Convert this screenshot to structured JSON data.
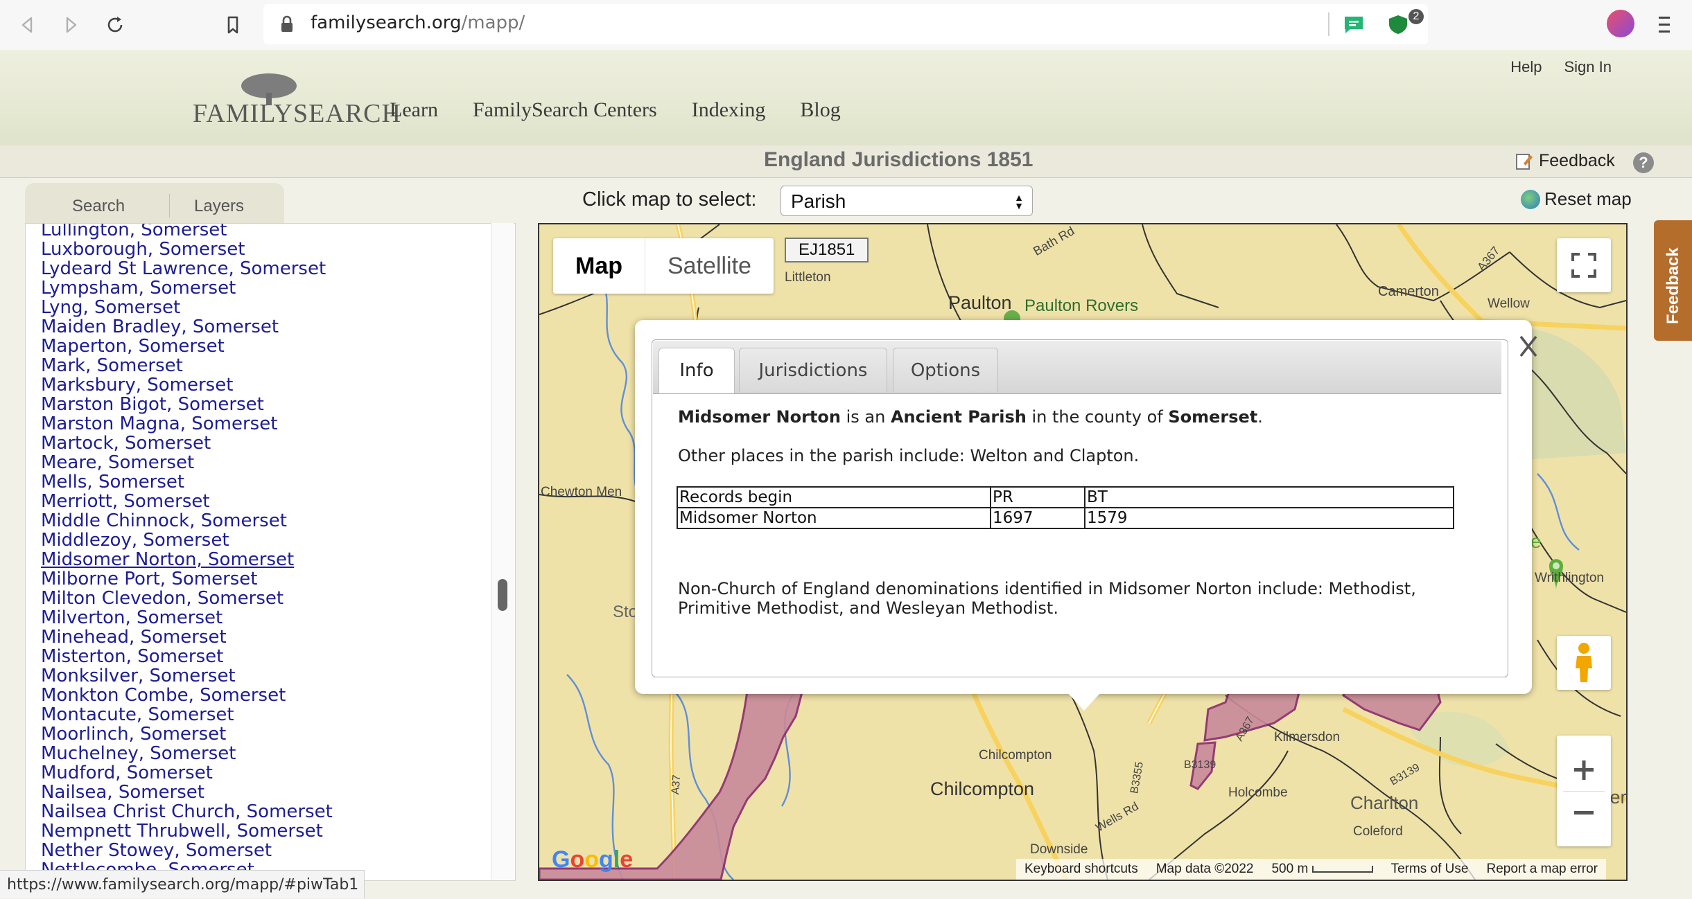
{
  "browser": {
    "url_host": "familysearch.org",
    "url_path": "/mapp/",
    "extension_badge": "2",
    "status_url": "https://www.familysearch.org/mapp/#piwTab1"
  },
  "site": {
    "logo_text": "FAMILYSEARCH",
    "nav": [
      "Learn",
      "FamilySearch Centers",
      "Indexing",
      "Blog"
    ],
    "help": "Help",
    "sign_in": "Sign In"
  },
  "title_bar": {
    "title": "England Jurisdictions 1851",
    "feedback": "Feedback",
    "help_glyph": "?"
  },
  "left_panel": {
    "tabs": [
      "Search",
      "Layers"
    ],
    "places": [
      "Lullington, Somerset",
      "Luxborough, Somerset",
      "Lydeard St Lawrence, Somerset",
      "Lympsham, Somerset",
      "Lyng, Somerset",
      "Maiden Bradley, Somerset",
      "Maperton, Somerset",
      "Mark, Somerset",
      "Marksbury, Somerset",
      "Marston Bigot, Somerset",
      "Marston Magna, Somerset",
      "Martock, Somerset",
      "Meare, Somerset",
      "Mells, Somerset",
      "Merriott, Somerset",
      "Middle Chinnock, Somerset",
      "Middlezoy, Somerset",
      "Midsomer Norton, Somerset",
      "Milborne Port, Somerset",
      "Milton Clevedon, Somerset",
      "Milverton, Somerset",
      "Minehead, Somerset",
      "Misterton, Somerset",
      "Monksilver, Somerset",
      "Monkton Combe, Somerset",
      "Montacute, Somerset",
      "Moorlinch, Somerset",
      "Muchelney, Somerset",
      "Mudford, Somerset",
      "Nailsea, Somerset",
      "Nailsea Christ Church, Somerset",
      "Nempnett Thrubwell, Somerset",
      "Nether Stowey, Somerset",
      "Nettlecombe, Somerset"
    ],
    "active_index": 17
  },
  "map_controls": {
    "select_label": "Click map to select:",
    "select_value": "Parish",
    "reset": "Reset map",
    "map_type": [
      "Map",
      "Satellite"
    ],
    "layer_label": "EJ1851",
    "side_feedback": "Feedback"
  },
  "map_labels": {
    "bath_rd": "Bath Rd",
    "paulton": "Paulton",
    "paulton_rovers": "Paulton Rovers",
    "camerton": "Camerton",
    "wellow": "Wellow",
    "a367_top": "A367",
    "littleton": "Littleton",
    "chewton": "Chewton Men",
    "sto": "Sto",
    "writhlington": "Writhlington",
    "kilmersdon": "Kilmersdon",
    "chilcompton_small": "Chilcompton",
    "chilcompton": "Chilcompton",
    "holcombe": "Holcombe",
    "charlton": "Charlton",
    "kilmers": "Kilmers",
    "coleford": "Coleford",
    "downside": "Downside",
    "b3139a": "B3139",
    "b3139b": "B3139",
    "b3355": "B3355",
    "a37": "A37",
    "a367_mid": "A367",
    "wells_rd": "Wells Rd",
    "e_label": "e"
  },
  "map_footer": {
    "shortcuts": "Keyboard shortcuts",
    "map_data": "Map data ©2022",
    "scale": "500 m",
    "terms": "Terms of Use",
    "report": "Report a map error",
    "google": [
      "G",
      "o",
      "o",
      "g",
      "l",
      "e"
    ]
  },
  "popup": {
    "tabs": [
      "Info",
      "Jurisdictions",
      "Options"
    ],
    "place": "Midsomer Norton",
    "is_an": " is an ",
    "type": "Ancient Parish",
    "in_county": " in the county of ",
    "county": "Somerset",
    "period": ".",
    "other_places": "Other places in the parish include: Welton and Clapton.",
    "table": {
      "header": [
        "Records begin",
        "PR",
        "BT"
      ],
      "row": [
        "Midsomer Norton",
        "1697",
        "1579"
      ]
    },
    "denominations": "Non-Church of England denominations identified in Midsomer Norton include: Methodist, Primitive Methodist, and Wesleyan Methodist."
  },
  "colors": {
    "link_blue": "#1d1d96",
    "parish_fill": "#c98a9a",
    "parish_border": "#8b2a6e",
    "map_land": "#efe2a8",
    "feedback_tab": "#b56d2c"
  }
}
